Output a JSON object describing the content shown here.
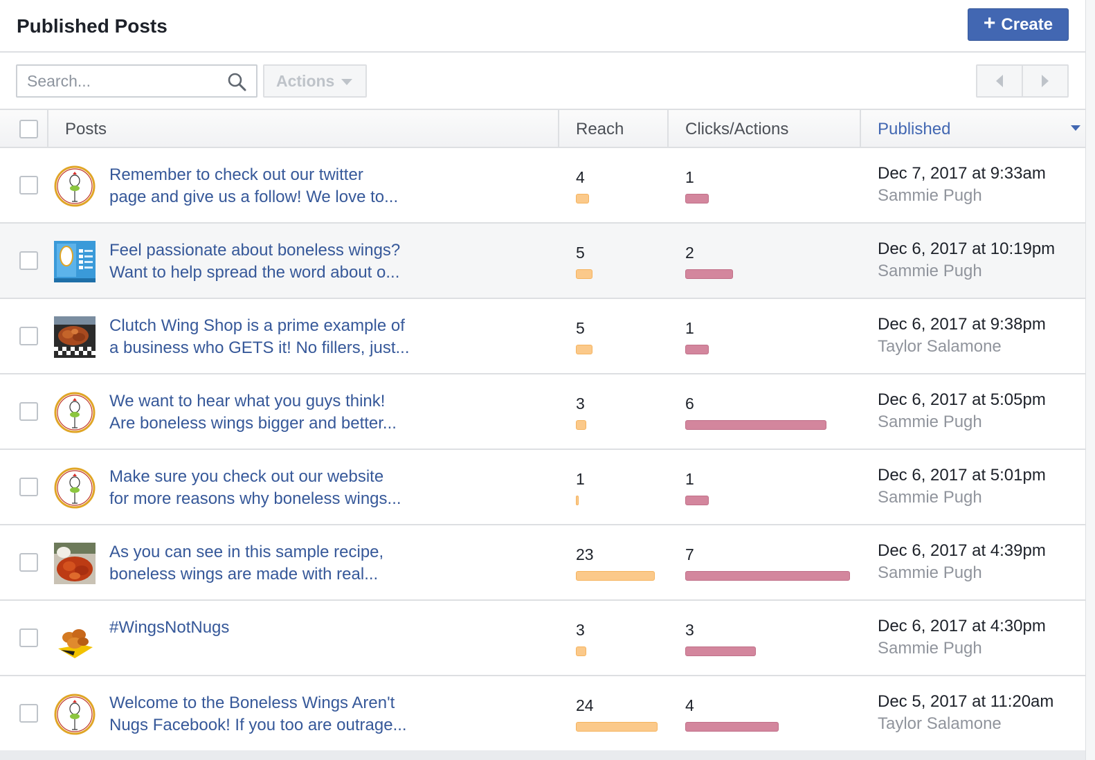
{
  "header": {
    "title": "Published Posts",
    "create_label": "Create"
  },
  "toolbar": {
    "search_placeholder": "Search...",
    "actions_label": "Actions"
  },
  "table": {
    "columns": {
      "posts": "Posts",
      "reach": "Reach",
      "clicks": "Clicks/Actions",
      "published": "Published"
    },
    "sorted_by": "Published",
    "rows": [
      {
        "text_line1": "Remember to check out our twitter",
        "text_line2": "page and give us a follow! We love to...",
        "thumb": "logo",
        "reach": "4",
        "clicks": "1",
        "date": "Dec 7, 2017 at 9:33am",
        "author": "Sammie Pugh"
      },
      {
        "text_line1": "Feel passionate about boneless wings?",
        "text_line2": "Want to help spread the word about o...",
        "thumb": "poster",
        "reach": "5",
        "clicks": "2",
        "date": "Dec 6, 2017 at 10:19pm",
        "author": "Sammie Pugh"
      },
      {
        "text_line1": "Clutch Wing Shop is a prime example of",
        "text_line2": "a business who GETS it! No fillers, just...",
        "thumb": "photo-wings-checkered",
        "reach": "5",
        "clicks": "1",
        "date": "Dec 6, 2017 at 9:38pm",
        "author": "Taylor Salamone"
      },
      {
        "text_line1": "We want to hear what you guys think!",
        "text_line2": "Are boneless wings bigger and better...",
        "thumb": "logo",
        "reach": "3",
        "clicks": "6",
        "date": "Dec 6, 2017 at 5:05pm",
        "author": "Sammie Pugh"
      },
      {
        "text_line1": "Make sure you check out our website",
        "text_line2": "for more reasons why boneless wings...",
        "thumb": "logo",
        "reach": "1",
        "clicks": "1",
        "date": "Dec 6, 2017 at 5:01pm",
        "author": "Sammie Pugh"
      },
      {
        "text_line1": "As you can see in this sample recipe,",
        "text_line2": "boneless wings are made with real...",
        "thumb": "photo-wings-plate",
        "reach": "23",
        "clicks": "7",
        "date": "Dec 6, 2017 at 4:39pm",
        "author": "Sammie Pugh"
      },
      {
        "text_line1": "#WingsNotNugs",
        "text_line2": "",
        "thumb": "photo-nuggets",
        "reach": "3",
        "clicks": "3",
        "date": "Dec 6, 2017 at 4:30pm",
        "author": "Sammie Pugh"
      },
      {
        "text_line1": "Welcome to the Boneless Wings Aren't",
        "text_line2": "Nugs Facebook! If you too are outrage...",
        "thumb": "logo",
        "reach": "24",
        "clicks": "4",
        "date": "Dec 5, 2017 at 11:20am",
        "author": "Taylor Salamone"
      }
    ]
  },
  "colors": {
    "brand_blue": "#4267b2",
    "link_blue": "#365899",
    "reach_bar": "#fbc98a",
    "clicks_bar": "#d3869d"
  }
}
